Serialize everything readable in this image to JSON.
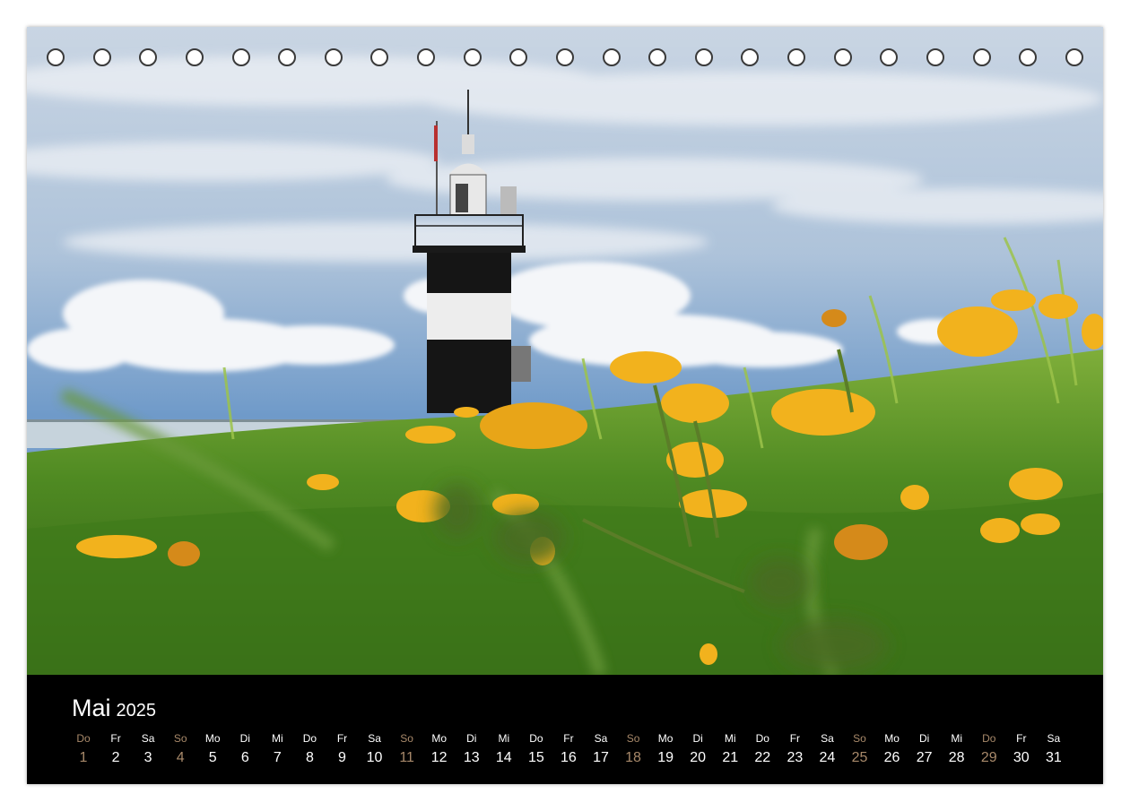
{
  "calendar": {
    "month": "Mai",
    "year": "2025",
    "days": [
      {
        "wd": "Do",
        "n": "1",
        "type": "hol"
      },
      {
        "wd": "Fr",
        "n": "2",
        "type": ""
      },
      {
        "wd": "Sa",
        "n": "3",
        "type": ""
      },
      {
        "wd": "So",
        "n": "4",
        "type": "sun"
      },
      {
        "wd": "Mo",
        "n": "5",
        "type": ""
      },
      {
        "wd": "Di",
        "n": "6",
        "type": ""
      },
      {
        "wd": "Mi",
        "n": "7",
        "type": ""
      },
      {
        "wd": "Do",
        "n": "8",
        "type": ""
      },
      {
        "wd": "Fr",
        "n": "9",
        "type": ""
      },
      {
        "wd": "Sa",
        "n": "10",
        "type": ""
      },
      {
        "wd": "So",
        "n": "11",
        "type": "sun"
      },
      {
        "wd": "Mo",
        "n": "12",
        "type": ""
      },
      {
        "wd": "Di",
        "n": "13",
        "type": ""
      },
      {
        "wd": "Mi",
        "n": "14",
        "type": ""
      },
      {
        "wd": "Do",
        "n": "15",
        "type": ""
      },
      {
        "wd": "Fr",
        "n": "16",
        "type": ""
      },
      {
        "wd": "Sa",
        "n": "17",
        "type": ""
      },
      {
        "wd": "So",
        "n": "18",
        "type": "sun"
      },
      {
        "wd": "Mo",
        "n": "19",
        "type": ""
      },
      {
        "wd": "Di",
        "n": "20",
        "type": ""
      },
      {
        "wd": "Mi",
        "n": "21",
        "type": ""
      },
      {
        "wd": "Do",
        "n": "22",
        "type": ""
      },
      {
        "wd": "Fr",
        "n": "23",
        "type": ""
      },
      {
        "wd": "Sa",
        "n": "24",
        "type": ""
      },
      {
        "wd": "So",
        "n": "25",
        "type": "sun"
      },
      {
        "wd": "Mo",
        "n": "26",
        "type": ""
      },
      {
        "wd": "Di",
        "n": "27",
        "type": ""
      },
      {
        "wd": "Mi",
        "n": "28",
        "type": ""
      },
      {
        "wd": "Do",
        "n": "29",
        "type": "hol"
      },
      {
        "wd": "Fr",
        "n": "30",
        "type": ""
      },
      {
        "wd": "Sa",
        "n": "31",
        "type": ""
      }
    ],
    "colors": {
      "background": "#000000",
      "text": "#ffffff",
      "weekend": "#a8896a"
    }
  },
  "photo": {
    "subject": "lighthouse-in-dandelion-meadow",
    "colors": {
      "sky": "#8fb0d4",
      "cloud": "#f2f4f7",
      "grass": "#4f8a22",
      "flower": "#f2b21d",
      "tower_dark": "#151515",
      "tower_light": "#ededed"
    }
  },
  "binding": {
    "hole_count": 23
  }
}
